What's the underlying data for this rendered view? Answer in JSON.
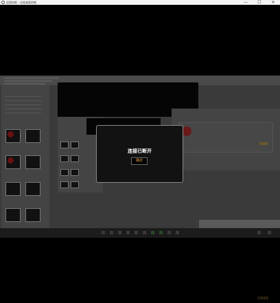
{
  "window": {
    "title": "远程协助 - 远程桌面控制",
    "minimize_glyph": "—",
    "maximize_glyph": "☐",
    "close_glyph": "✕"
  },
  "dialog": {
    "message": "连接已断开",
    "ok_label": "确定"
  },
  "watermark": "远程桌面"
}
